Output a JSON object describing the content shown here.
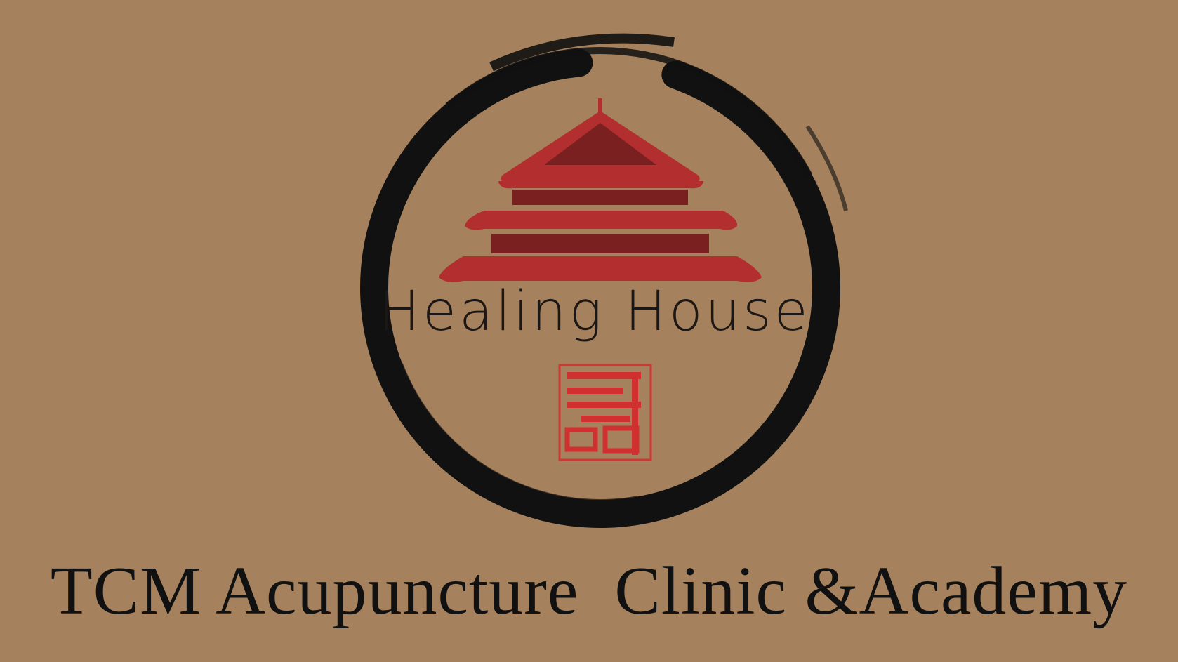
{
  "brand": {
    "name": "Healing House",
    "tagline": "TCM Acupuncture  Clinic &Academy"
  },
  "logo": {
    "pagoda_icon": "pagoda-icon",
    "seal_icon": "seal-icon",
    "ring_icon": "enso-circle-icon"
  },
  "colors": {
    "background": "#a5825d",
    "roof_red": "#b32e2e",
    "roof_dark": "#7a2020",
    "ink": "#111111",
    "seal_red": "#d13030"
  }
}
